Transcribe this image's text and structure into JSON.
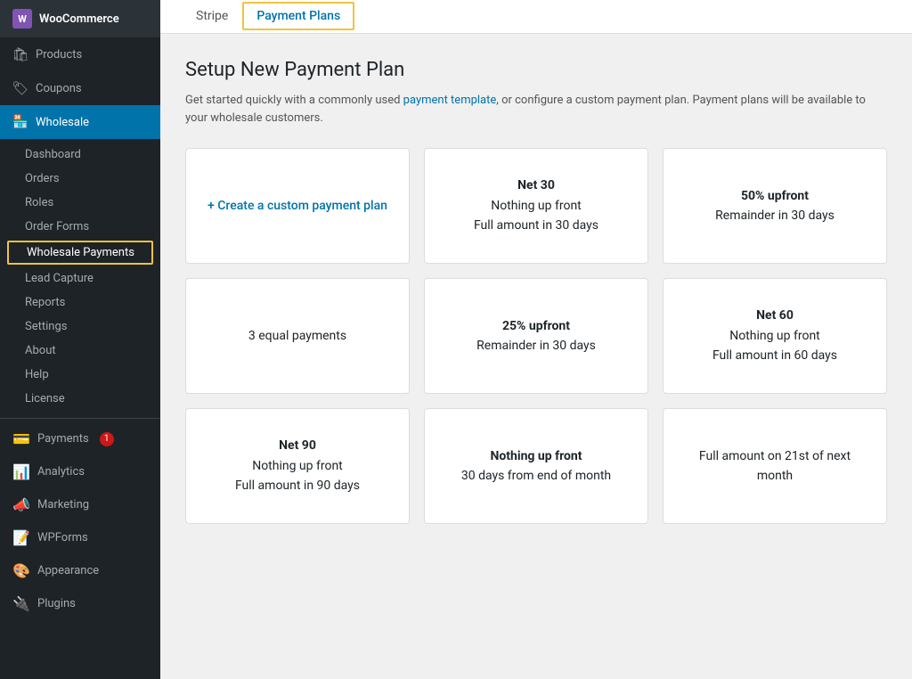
{
  "sidebar": {
    "woo_label": "WooCommerce",
    "items_top": [
      {
        "id": "products",
        "label": "Products",
        "icon": "🛍"
      },
      {
        "id": "coupons",
        "label": "Coupons",
        "icon": "🏷"
      }
    ],
    "wholesale": {
      "label": "Wholesale",
      "icon": "🏪",
      "submenu": [
        {
          "id": "dashboard",
          "label": "Dashboard",
          "active": false
        },
        {
          "id": "orders",
          "label": "Orders",
          "active": false
        },
        {
          "id": "roles",
          "label": "Roles",
          "active": false
        },
        {
          "id": "order-forms",
          "label": "Order Forms",
          "active": false
        },
        {
          "id": "wholesale-payments",
          "label": "Wholesale Payments",
          "active": true
        },
        {
          "id": "lead-capture",
          "label": "Lead Capture",
          "active": false
        },
        {
          "id": "reports",
          "label": "Reports",
          "active": false
        },
        {
          "id": "settings",
          "label": "Settings",
          "active": false
        },
        {
          "id": "about",
          "label": "About",
          "active": false
        },
        {
          "id": "help",
          "label": "Help",
          "active": false
        },
        {
          "id": "license",
          "label": "License",
          "active": false
        }
      ]
    },
    "items_bottom": [
      {
        "id": "payments",
        "label": "Payments",
        "icon": "💳",
        "badge": "1"
      },
      {
        "id": "analytics",
        "label": "Analytics",
        "icon": "📊",
        "badge": ""
      },
      {
        "id": "marketing",
        "label": "Marketing",
        "icon": "📣",
        "badge": ""
      },
      {
        "id": "wpforms",
        "label": "WPForms",
        "icon": "📝",
        "badge": ""
      },
      {
        "id": "appearance",
        "label": "Appearance",
        "icon": "🎨",
        "badge": ""
      },
      {
        "id": "plugins",
        "label": "Plugins",
        "icon": "🔌",
        "badge": ""
      }
    ]
  },
  "tabs": [
    {
      "id": "stripe",
      "label": "Stripe",
      "active": false,
      "highlighted": false
    },
    {
      "id": "payment-plans",
      "label": "Payment Plans",
      "active": true,
      "highlighted": true
    }
  ],
  "content": {
    "title": "Setup New Payment Plan",
    "description_parts": [
      "Get started quickly with a commonly used ",
      "payment template",
      ", or configure a custom payment plan. Payment plans will be available to your wholesale customers."
    ],
    "cards": [
      {
        "id": "custom",
        "lines": [
          "+ Create a custom payment plan"
        ],
        "is_create": true
      },
      {
        "id": "net30",
        "lines": [
          "Net 30",
          "Nothing up front",
          "Full amount in 30 days"
        ],
        "is_create": false
      },
      {
        "id": "50upfront",
        "lines": [
          "50% upfront",
          "Remainder in 30 days"
        ],
        "is_create": false
      },
      {
        "id": "3equal",
        "lines": [
          "3 equal payments"
        ],
        "is_create": false
      },
      {
        "id": "25upfront",
        "lines": [
          "25% upfront",
          "Remainder in 30 days"
        ],
        "is_create": false
      },
      {
        "id": "net60",
        "lines": [
          "Net 60",
          "Nothing up front",
          "Full amount in 60 days"
        ],
        "is_create": false
      },
      {
        "id": "net90",
        "lines": [
          "Net 90",
          "Nothing up front",
          "Full amount in 90 days"
        ],
        "is_create": false
      },
      {
        "id": "nothing-upfront-30",
        "lines": [
          "Nothing up front",
          "30 days from end of month"
        ],
        "is_create": false
      },
      {
        "id": "full-21st",
        "lines": [
          "Full amount on 21st of next",
          "month"
        ],
        "is_create": false
      }
    ]
  }
}
